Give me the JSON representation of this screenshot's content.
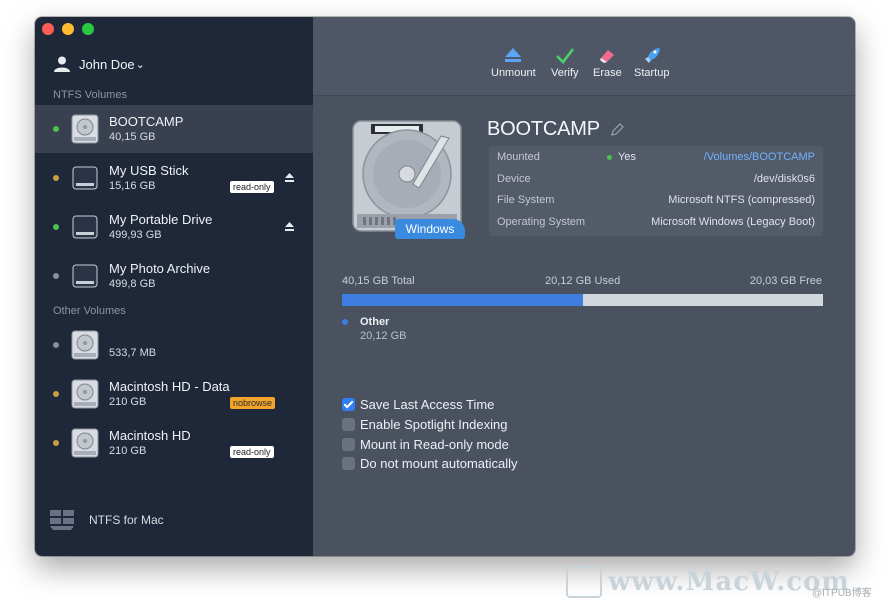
{
  "user": {
    "name": "John Doe",
    "chevron": "⌄"
  },
  "sidebar": {
    "ntfs_title": "NTFS Volumes",
    "other_title": "Other Volumes",
    "footer_label": "NTFS for Mac",
    "volumes": [
      {
        "name": "BOOTCAMP",
        "size": "40,15 GB",
        "dot_color": "#4cc24c",
        "badge": "",
        "ejectable": false
      },
      {
        "name": "My USB Stick",
        "size": "15,16 GB",
        "dot_color": "#c8a043",
        "badge": "read-only",
        "ejectable": true
      },
      {
        "name": "My Portable Drive",
        "size": "499,93 GB",
        "dot_color": "#4cc24c",
        "badge": "",
        "ejectable": true
      },
      {
        "name": "My Photo Archive",
        "size": "499,8 GB",
        "dot_color": "#8a8f98",
        "badge": "",
        "ejectable": false
      }
    ],
    "other_volumes": [
      {
        "name": "",
        "size": "533,7 MB",
        "dot_color": "#8a8f98",
        "badge": ""
      },
      {
        "name": "Macintosh HD - Data",
        "size": "210 GB",
        "dot_color": "#c8a043",
        "badge": "nobrowse"
      },
      {
        "name": "Macintosh HD",
        "size": "210 GB",
        "dot_color": "#c8a043",
        "badge": "read-only"
      }
    ]
  },
  "toolbar": {
    "unmount": "Unmount",
    "verify": "Verify",
    "erase": "Erase",
    "startup": "Startup"
  },
  "detail": {
    "title": "BOOTCAMP",
    "os_tag": "Windows",
    "info": {
      "mounted_label": "Mounted",
      "mounted_status": "Yes",
      "mount_path": "/Volumes/BOOTCAMP",
      "device_label": "Device",
      "device": "/dev/disk0s6",
      "fs_label": "File System",
      "fs": "Microsoft NTFS (compressed)",
      "os_label": "Operating System",
      "os": "Microsoft Windows (Legacy Boot)"
    },
    "usage": {
      "total": "40,15 GB Total",
      "used": "20,12 GB Used",
      "free": "20,03 GB Free",
      "used_fraction": 0.501,
      "legend_name": "Other",
      "legend_size": "20,12 GB"
    },
    "options": [
      {
        "label": "Save Last Access Time",
        "checked": true
      },
      {
        "label": "Enable Spotlight Indexing",
        "checked": false
      },
      {
        "label": "Mount in Read-only mode",
        "checked": false
      },
      {
        "label": "Do not mount automatically",
        "checked": false
      }
    ]
  },
  "watermark": {
    "site": "www.MacW.com",
    "credit": "@ITPUB博客"
  },
  "colors": {
    "accent": "#3d7ee0",
    "sidebar_bg": "#1f2839",
    "main_bg": "#4a5260"
  }
}
